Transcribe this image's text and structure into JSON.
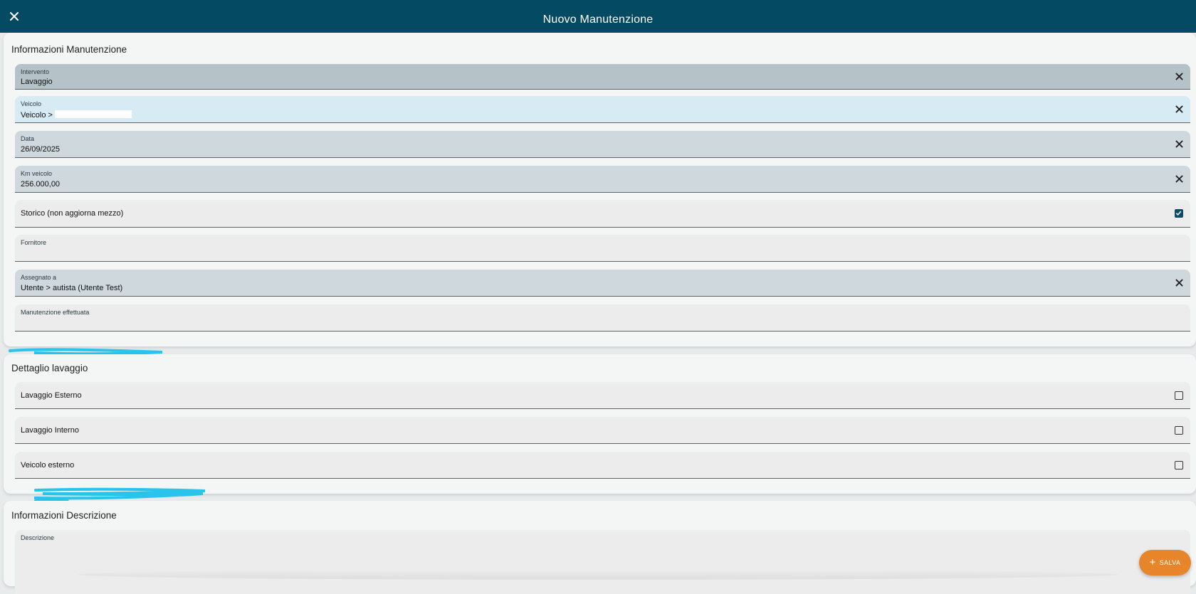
{
  "header": {
    "title": "Nuovo Manutenzione",
    "close_icon": "close-icon"
  },
  "info_manutenzione": {
    "title": "Informazioni Manutenzione",
    "intervento": {
      "label": "Intervento",
      "value": "Lavaggio"
    },
    "veicolo": {
      "label": "Veicolo",
      "value": "Veicolo >"
    },
    "data": {
      "label": "Data",
      "value": "26/09/2025"
    },
    "km": {
      "label": "Km veicolo",
      "value": "256.000,00"
    },
    "storico": {
      "label": "Storico (non aggiorna mezzo)",
      "checked": true
    },
    "fornitore": {
      "label": "Fornitore",
      "value": ""
    },
    "assegnato": {
      "label": "Assegnato a",
      "value": "Utente > autista (Utente Test)"
    },
    "manutenzione_effettuata": {
      "label": "Manutenzione effettuata",
      "value": ""
    }
  },
  "dettaglio_lavaggio": {
    "title": "Dettaglio lavaggio",
    "items": [
      {
        "label": "Lavaggio Esterno",
        "checked": false
      },
      {
        "label": "Lavaggio Interno",
        "checked": false
      },
      {
        "label": "Veicolo esterno",
        "checked": false
      }
    ]
  },
  "info_descrizione": {
    "title": "Informazioni Descrizione",
    "descrizione": {
      "label": "Descrizione",
      "value": ""
    }
  },
  "fab": {
    "label": "SALVA",
    "icon": "plus-icon"
  },
  "colors": {
    "header_bg": "#044a62",
    "accent_orange": "#e6852a",
    "checkbox_checked": "#0b4b63",
    "scribble": "#29c4ec"
  }
}
